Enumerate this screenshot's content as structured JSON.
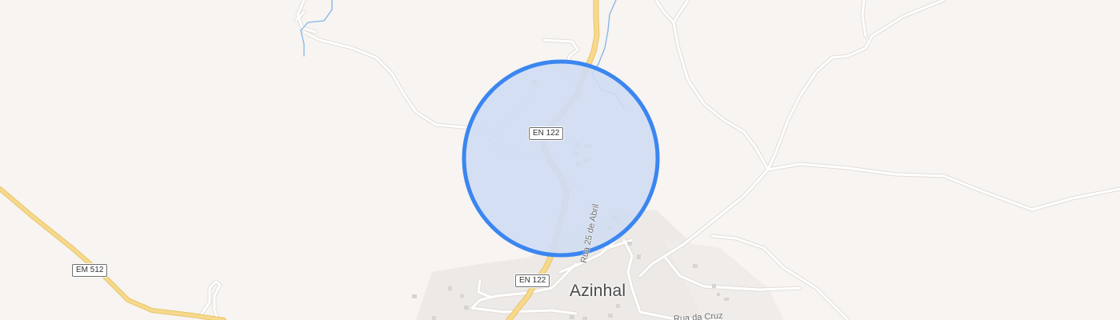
{
  "map": {
    "town_label": "Azinhal",
    "roads": {
      "en122_top": "EN 122",
      "en122_bottom": "EN 122",
      "em512": "EM 512"
    },
    "streets": {
      "rua_25_abril": "Rua 25 de Abril",
      "rua_cruz": "Rua da Cruz"
    },
    "radius_circle": {
      "fill_color": "#cfdcf3",
      "stroke_color": "#3b86f0"
    },
    "colors": {
      "background": "#f7f4f1",
      "minor_road": "#ffffff",
      "main_road": "#f4d27e",
      "secondary_road": "#d8d0a6",
      "water": "#82b4e8",
      "urban_area": "#ece9e6"
    }
  }
}
